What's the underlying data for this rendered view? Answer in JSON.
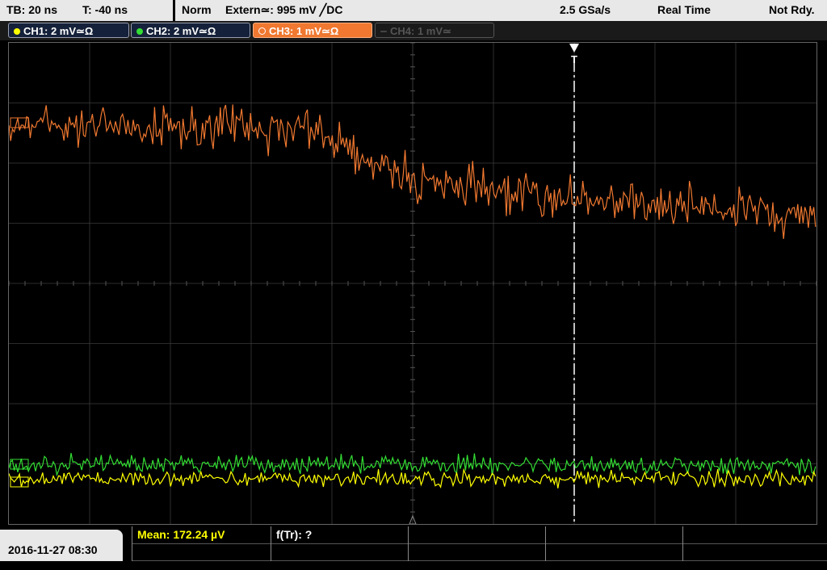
{
  "status": {
    "timebase": "TB: 20 ns",
    "trigger_offset": "T: -40 ns",
    "mode": "Norm",
    "trigger_source": "Extern≃: 995 mV ╱DC",
    "sample_rate": "2.5 GSa/s",
    "acq_mode": "Real Time",
    "state": "Not Rdy."
  },
  "channels": [
    {
      "label": "CH1: 2 mV≃Ω",
      "color": "#ffff00",
      "state": "on"
    },
    {
      "label": "CH2: 2 mV≃Ω",
      "color": "#33dd33",
      "state": "on"
    },
    {
      "label": "CH3: 1 mV≃Ω",
      "color": "#f07830",
      "state": "active"
    },
    {
      "label": "CH4: 1 mV≃",
      "color": "#555555",
      "state": "off"
    }
  ],
  "footer": {
    "datetime": "2016-11-27 08:30",
    "measurement_1": "Mean: 172.24 µV",
    "measurement_2": "f(Tr): ?"
  },
  "colors": {
    "ch1": "#ffff00",
    "ch2": "#33dd33",
    "ch3": "#f07830",
    "grid": "#3a3a3a",
    "trigger_line": "#ffffff"
  },
  "icons": {
    "trigger_marker": "trigger-position-icon",
    "ground_marker": "ground-level-icon"
  }
}
